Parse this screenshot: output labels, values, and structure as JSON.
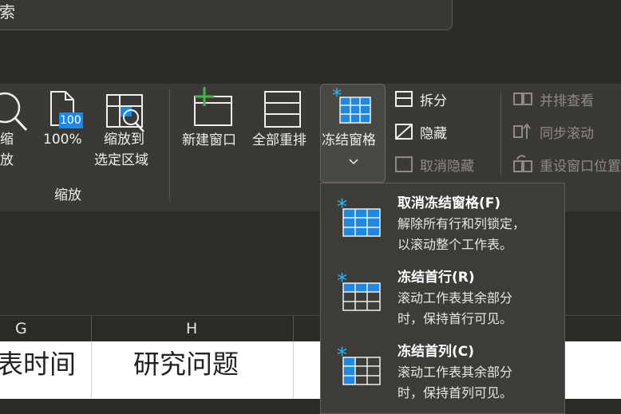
{
  "search": {
    "text": "索"
  },
  "ribbon": {
    "zoom_group": {
      "zoom_label_1": "缩",
      "zoom_label_2": "放",
      "hundred_label": "100%",
      "hundred_badge": "100",
      "zoom_sel_label_1": "缩放到",
      "zoom_sel_label_2": "选定区域",
      "group_label": "缩放"
    },
    "window_group": {
      "new_window": "新建窗口",
      "arrange_all": "全部重排",
      "freeze_panes": "冻结窗格",
      "split": "拆分",
      "hide": "隐藏",
      "unhide": "取消隐藏",
      "side_by_side": "并排查看",
      "sync_scroll": "同步滚动",
      "reset_position": "重设窗口位置"
    }
  },
  "grid": {
    "columns": [
      "G",
      "H"
    ],
    "cells": [
      "表时间",
      "研究问题"
    ]
  },
  "menu": {
    "items": [
      {
        "title": "取消冻结窗格(F)",
        "desc_1": "解除所有行和列锁定，",
        "desc_2": "以滚动整个工作表。"
      },
      {
        "title": "冻结首行(R)",
        "desc_1": "滚动工作表其余部分",
        "desc_2": "时，保持首行可见。"
      },
      {
        "title": "冻结首列(C)",
        "desc_1": "滚动工作表其余部分",
        "desc_2": "时，保持首列可见。"
      }
    ]
  },
  "colors": {
    "accent_blue": "#1e88e5",
    "highlight_green": "#4caf50"
  }
}
